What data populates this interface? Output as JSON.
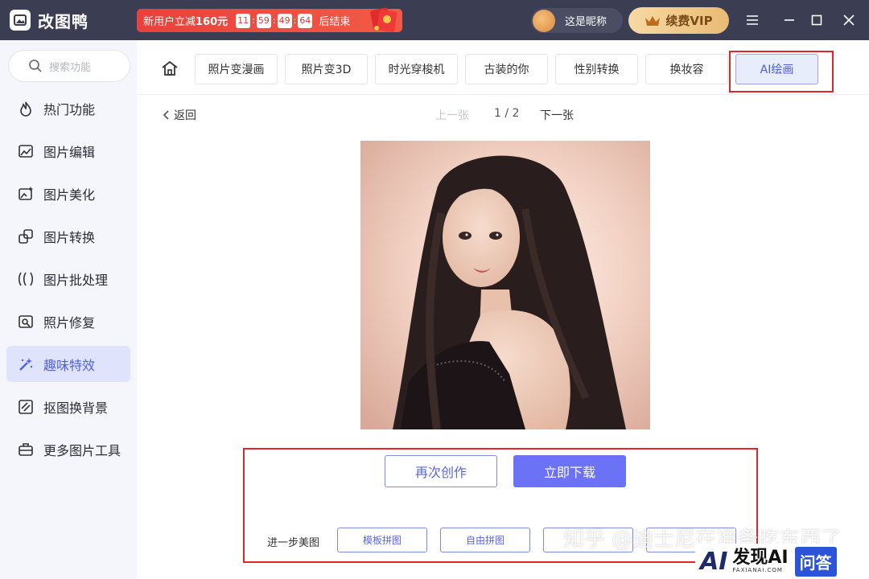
{
  "app": {
    "name": "改图鸭"
  },
  "promo": {
    "text_prefix": "新用户立减",
    "amount": "160元",
    "countdown": [
      "11",
      "59",
      "49",
      "64"
    ],
    "text_suffix": "后结束"
  },
  "user": {
    "nickname": "这是昵称"
  },
  "vip": {
    "label": "续费VIP"
  },
  "search": {
    "placeholder": "搜索功能"
  },
  "sidebar": {
    "items": [
      {
        "label": "热门功能",
        "icon": "fire-icon"
      },
      {
        "label": "图片编辑",
        "icon": "image-edit-icon"
      },
      {
        "label": "图片美化",
        "icon": "image-beautify-icon"
      },
      {
        "label": "图片转换",
        "icon": "image-convert-icon"
      },
      {
        "label": "图片批处理",
        "icon": "batch-icon"
      },
      {
        "label": "照片修复",
        "icon": "photo-repair-icon"
      },
      {
        "label": "趣味特效",
        "icon": "magic-wand-icon",
        "active": true
      },
      {
        "label": "抠图换背景",
        "icon": "cutout-icon"
      },
      {
        "label": "更多图片工具",
        "icon": "toolbox-icon"
      }
    ]
  },
  "tabs": [
    "照片变漫画",
    "照片变3D",
    "时光穿梭机",
    "古装的你",
    "性别转换",
    "换妆容",
    "AI绘画"
  ],
  "nav": {
    "back": "返回",
    "prev": "上一张",
    "page": "1 / 2",
    "next": "下一张"
  },
  "actions": {
    "recreate": "再次创作",
    "download": "立即下载"
  },
  "further": {
    "label": "进一步美图",
    "buttons": [
      "模板拼图",
      "自由拼图",
      "",
      ""
    ]
  },
  "watermark": {
    "text": "知乎 @迪士尼在准备吃东西了"
  },
  "badge": {
    "ai": "AI",
    "title": "发现AI",
    "sub": "FAXIANAI.COM",
    "ask": "问答"
  },
  "colors": {
    "accent": "#6c72f5",
    "titlebar": "#3b3d52",
    "active_nav_bg": "#dfe3fb",
    "highlight_box": "#e0262a"
  }
}
